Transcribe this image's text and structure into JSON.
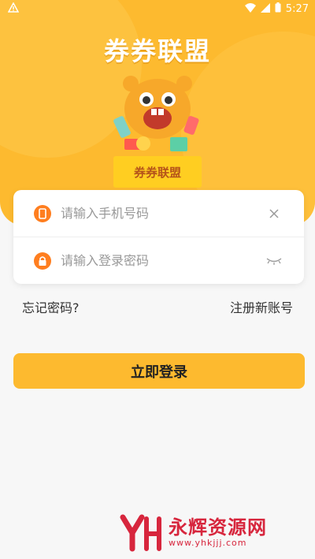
{
  "status": {
    "time": "5:27",
    "left_icon": "warning-icon",
    "icons": [
      "wifi-icon",
      "signal-icon",
      "battery-icon"
    ]
  },
  "header": {
    "title": "券券联盟",
    "mascot_badge": "券券联盟"
  },
  "form": {
    "phone_placeholder": "请输入手机号码",
    "password_placeholder": "请输入登录密码"
  },
  "links": {
    "forgot": "忘记密码?",
    "register": "注册新账号"
  },
  "login_button": "立即登录",
  "watermark": {
    "name": "永辉资源网",
    "url": "www.yhkjjj.com"
  },
  "colors": {
    "primary": "#fdba2f",
    "icon_orange": "#ff7e1f",
    "watermark": "#d7263d"
  }
}
